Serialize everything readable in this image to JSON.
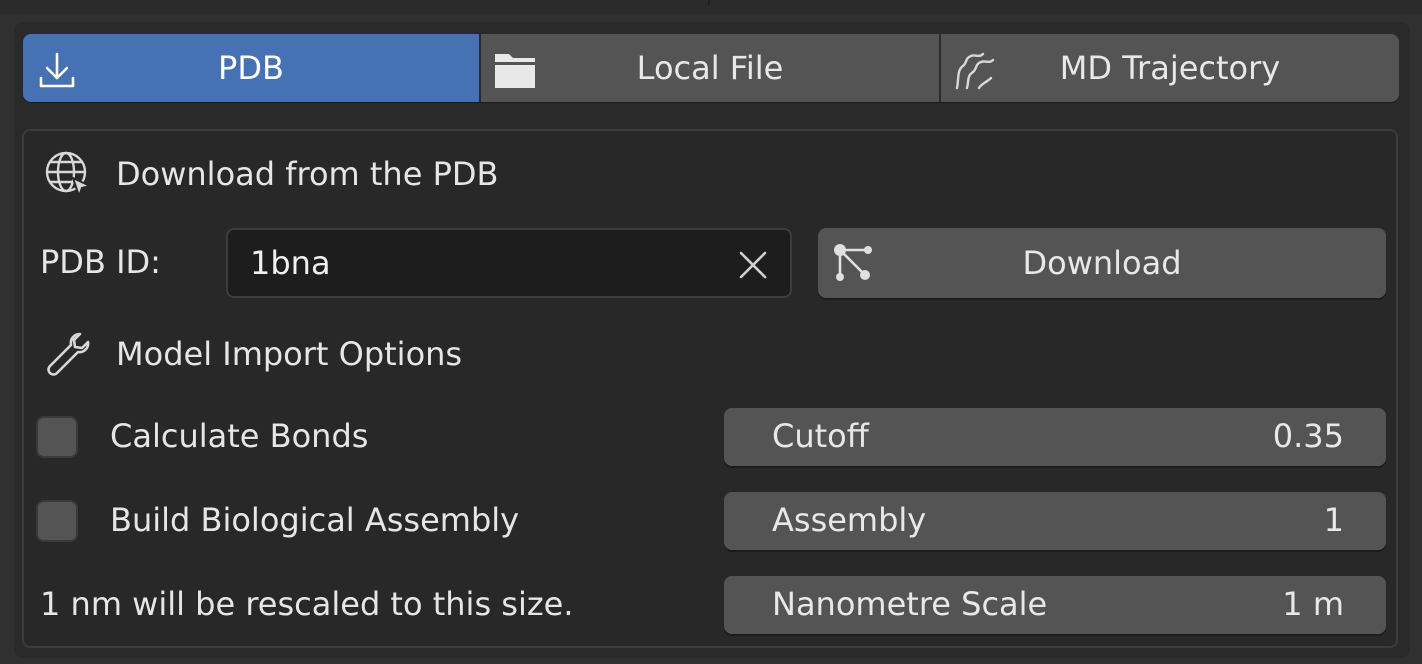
{
  "tabs": [
    {
      "label": "PDB",
      "icon": "download-icon",
      "active": true
    },
    {
      "label": "Local File",
      "icon": "folder-icon",
      "active": false
    },
    {
      "label": "MD Trajectory",
      "icon": "trajectory-icon",
      "active": false
    }
  ],
  "download_section": {
    "header": "Download from the PDB",
    "icon": "globe-cursor-icon",
    "pdb_id_label": "PDB ID:",
    "pdb_id_value": "1bna",
    "download_label": "Download",
    "download_icon": "molecule-network-icon"
  },
  "import_options": {
    "header": "Model Import Options",
    "icon": "wrench-icon",
    "calculate_bonds": {
      "label": "Calculate Bonds",
      "checked": false
    },
    "build_assembly": {
      "label": "Build Biological Assembly",
      "checked": false
    },
    "rescale_note": "1 nm will be rescaled to this size.",
    "cutoff": {
      "label": "Cutoff",
      "value": "0.35"
    },
    "assembly": {
      "label": "Assembly",
      "value": "1"
    },
    "nanometre_scale": {
      "label": "Nanometre Scale",
      "value": "1 m"
    }
  },
  "colors": {
    "accent": "#4672b4",
    "button": "#545454",
    "background": "#282828",
    "input": "#1d1d1d"
  }
}
